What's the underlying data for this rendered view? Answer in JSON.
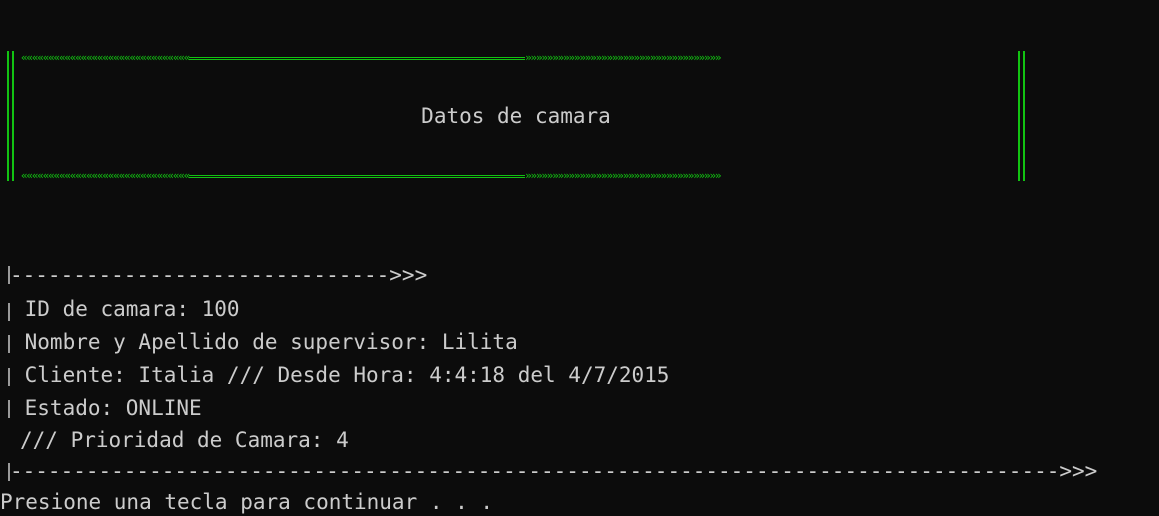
{
  "header": {
    "title": "Datos de camara",
    "frame_color": "#12c312",
    "left_chevrons": "«««««««««««««««««««««««««««««««",
    "right_chevrons": "»»»»»»»»»»»»»»»»»»»»»»»»»»»»»»»»»»»»"
  },
  "record": {
    "separator_top": "------------------------------>>>",
    "id_line": " ID de camara: 100",
    "supervisor_line": " Nombre y Apellido de supervisor: Lilita",
    "client_line": " Cliente: Italia /// Desde Hora: 4:4:18 del 4/7/2015",
    "state_line": " Estado: ONLINE",
    "priority_line": "/// Prioridad de Camara: 4",
    "separator_bottom": "----------------------------------------------------------------------------------->>>"
  },
  "prompt": {
    "text": "Presione una tecla para continuar . . ."
  },
  "colors": {
    "background": "#0c0c0c",
    "text": "#cccccc",
    "accent": "#12c312"
  }
}
